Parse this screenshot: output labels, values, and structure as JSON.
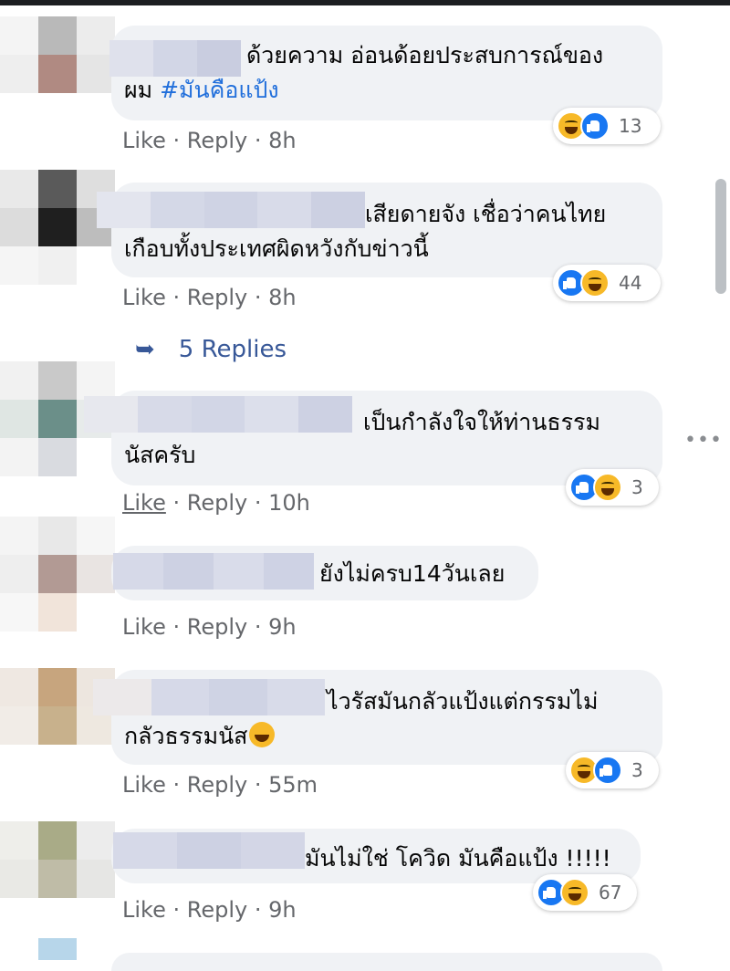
{
  "comments": [
    {
      "line1": "ด้วยความ อ่อนด้อยประสบการณ์ของ",
      "line2_prefix": "ผม ",
      "hashtag": "#มันคือแป้ง",
      "reactions": [
        "haha",
        "like"
      ],
      "count": "13",
      "like": "Like",
      "reply": "Reply",
      "time": "8h"
    },
    {
      "line1": "เสียดายจัง เชื่อว่าคนไทย",
      "line2": "เกือบทั้งประเทศผิดหวังกับข่าวนี้",
      "reactions": [
        "like",
        "haha"
      ],
      "count": "44",
      "like": "Like",
      "reply": "Reply",
      "time": "8h"
    },
    {
      "line1": "เป็นกำลังใจให้ท่านธรรม",
      "line2": "นัสครับ",
      "reactions": [
        "like",
        "haha"
      ],
      "count": "3",
      "like": "Like",
      "reply": "Reply",
      "time": "10h"
    },
    {
      "line1": "ยังไม่ครบ14วันเลย",
      "like": "Like",
      "reply": "Reply",
      "time": "9h"
    },
    {
      "line1": "ไวรัสมันกลัวแป้งแต่กรรมไม่",
      "line2": "กลัวธรรมนัส",
      "reactions": [
        "haha",
        "like"
      ],
      "count": "3",
      "like": "Like",
      "reply": "Reply",
      "time": "55m"
    },
    {
      "line1": "มันไม่ใช่ โควิด มันคือแป้ง !!!!!",
      "reactions": [
        "like",
        "haha"
      ],
      "count": "67",
      "like": "Like",
      "reply": "Reply",
      "time": "9h"
    }
  ],
  "view_replies": "5 Replies",
  "more_options": "•••",
  "separator": " · ",
  "colors": {
    "bubble": "#f0f2f5",
    "link": "#385898",
    "hashtag": "#216fdb",
    "meta": "#65676b",
    "like_blue": "#1877f2",
    "haha_yellow": "#f7b928"
  }
}
